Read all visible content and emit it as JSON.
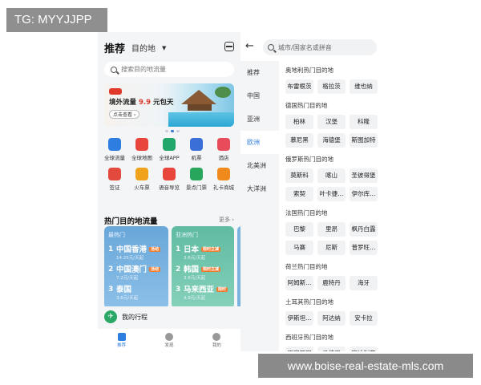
{
  "tg_label": "TG: MYYJJPP",
  "watermark": "www.boise-real-estate-mls.com",
  "left": {
    "title": "推荐",
    "dest_tab": "目的地",
    "search_placeholder": "搜索目的地流量",
    "banner": {
      "badge": "",
      "title_prefix": "境外流量 ",
      "price": "9.9",
      "title_suffix": " 元包天",
      "button": "点击查看 ›"
    },
    "grid": [
      {
        "label": "全球流量",
        "icon": "sim-card-icon",
        "color": "#2d7ee0"
      },
      {
        "label": "全球地图",
        "icon": "map-pin-icon",
        "color": "#e8453c"
      },
      {
        "label": "全球APP",
        "icon": "app-bag-icon",
        "color": "#23a66a"
      },
      {
        "label": "机票",
        "icon": "airplane-icon",
        "color": "#3a6fd8"
      },
      {
        "label": "酒店",
        "icon": "hotel-icon",
        "color": "#e84b5a"
      },
      {
        "label": "签证",
        "icon": "visa-icon",
        "color": "#e24a3e"
      },
      {
        "label": "火车票",
        "icon": "train-icon",
        "color": "#f0a21d"
      },
      {
        "label": "语音导览",
        "icon": "headphones-icon",
        "color": "#e8453c"
      },
      {
        "label": "景点门票",
        "icon": "ticket-icon",
        "color": "#27a65c"
      },
      {
        "label": "礼卡商城",
        "icon": "gift-icon",
        "color": "#f08a1d"
      }
    ],
    "hot_title": "热门目的地流量",
    "more": "更多 ›",
    "card1": {
      "header": "最热门",
      "items": [
        {
          "n": "1",
          "name": "中国香港",
          "sub": "14.25元/天起",
          "tag": "活动"
        },
        {
          "n": "2",
          "name": "中国澳门",
          "sub": "7.2元/天起",
          "tag": "活动"
        },
        {
          "n": "3",
          "name": "泰国",
          "sub": "3.6元/天起",
          "tag": ""
        }
      ]
    },
    "card2": {
      "header": "亚洲热门",
      "items": [
        {
          "n": "1",
          "name": "日本",
          "sub": "3.6元/天起",
          "tag": "限时立减"
        },
        {
          "n": "2",
          "name": "韩国",
          "sub": "3.6元/天起",
          "tag": "限时立减"
        },
        {
          "n": "3",
          "name": "马来西亚",
          "sub": "4.9元/天起",
          "tag": "限时"
        }
      ]
    },
    "trip": "我的行程",
    "tabs": [
      {
        "label": "推荐",
        "icon": "recommend-icon"
      },
      {
        "label": "发现",
        "icon": "discover-icon"
      },
      {
        "label": "我的",
        "icon": "profile-icon"
      }
    ]
  },
  "right": {
    "search_placeholder": "城市/国家名或拼音",
    "nav": [
      "推荐",
      "中国",
      "亚洲",
      "欧洲",
      "北美洲",
      "大洋洲"
    ],
    "active_nav": "欧洲",
    "sections": [
      {
        "title": "奥地利热门目的地",
        "chips": [
          "布雷根茨",
          "格拉茨",
          "维也纳"
        ]
      },
      {
        "title": "德国热门目的地",
        "chips": [
          "柏林",
          "汉堡",
          "科隆",
          "慕尼黑",
          "海德堡",
          "斯图加特"
        ]
      },
      {
        "title": "俄罗斯热门目的地",
        "chips": [
          "莫斯科",
          "喀山",
          "圣彼得堡",
          "索契",
          "叶卡捷...",
          "伊尔库..."
        ]
      },
      {
        "title": "法国热门目的地",
        "chips": [
          "巴黎",
          "里昂",
          "枫丹白露",
          "马赛",
          "尼斯",
          "普罗旺..."
        ]
      },
      {
        "title": "荷兰热门目的地",
        "chips": [
          "阿姆斯...",
          "鹿特丹",
          "海牙"
        ]
      },
      {
        "title": "土耳其热门目的地",
        "chips": [
          "伊斯坦...",
          "阿达纳",
          "安卡拉"
        ]
      },
      {
        "title": "西班牙热门目的地",
        "chips": [
          "巴塞罗那",
          "马德里",
          "塞维利亚"
        ]
      }
    ]
  }
}
